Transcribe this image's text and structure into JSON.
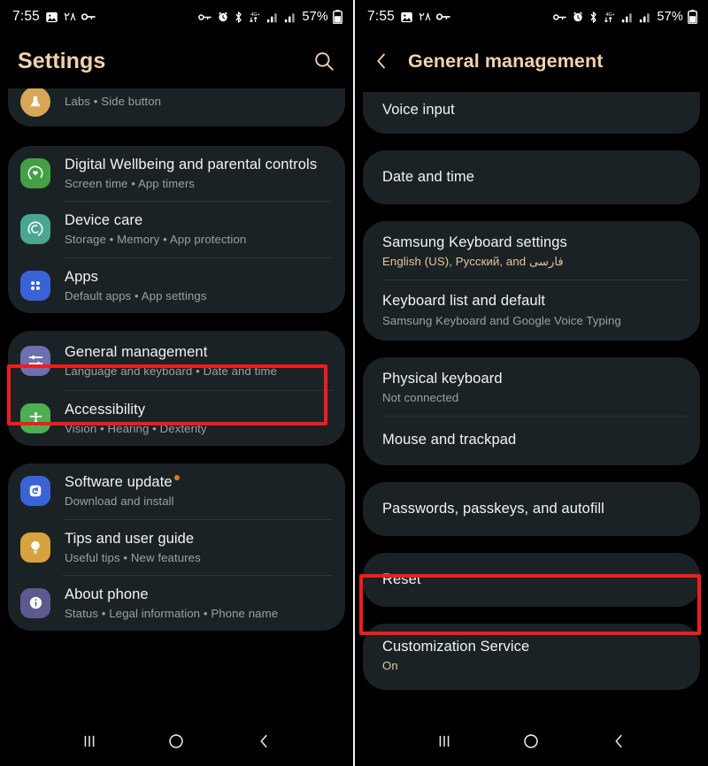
{
  "statusbar": {
    "time": "7:55",
    "arabic_indicator": "٢٨",
    "battery_percent": "57%",
    "icons": [
      "image-icon",
      "sim-key-icon",
      "vpn-key-icon",
      "alarm-icon",
      "bluetooth-icon",
      "data-transfer-4g-icon",
      "signal-bars-icon",
      "signal-bars-2-icon",
      "battery-icon"
    ]
  },
  "accent_color": "#f0d2ae",
  "highlight_color": "#ef1d1d",
  "left_screen": {
    "header": {
      "title": "Settings",
      "search_icon": "search-icon"
    },
    "groups": [
      {
        "clipped_top": true,
        "items": [
          {
            "label": "",
            "sub": "Labs  •  Side button",
            "icon": "labs-icon",
            "icon_color": "#d7a757",
            "partial": true
          }
        ]
      },
      {
        "items": [
          {
            "label": "Digital Wellbeing and parental controls",
            "sub": "Screen time  •  App timers",
            "icon": "wellbeing-icon",
            "icon_color": "#43a047"
          },
          {
            "label": "Device care",
            "sub": "Storage  •  Memory  •  App protection",
            "icon": "device-care-icon",
            "icon_color": "#4aa68f"
          },
          {
            "label": "Apps",
            "sub": "Default apps  •  App settings",
            "icon": "apps-icon",
            "icon_color": "#3a63d8"
          }
        ]
      },
      {
        "highlighted_index": 0,
        "items": [
          {
            "label": "General management",
            "sub": "Language and keyboard  •  Date and time",
            "icon": "sliders-icon",
            "icon_color": "#6e6fae"
          },
          {
            "label": "Accessibility",
            "sub": "Vision  •  Hearing  •  Dexterity",
            "icon": "accessibility-icon",
            "icon_color": "#4caf50"
          }
        ]
      },
      {
        "items": [
          {
            "label": "Software update",
            "sub": "Download and install",
            "icon": "software-update-icon",
            "icon_color": "#3a63d8",
            "badge": true
          },
          {
            "label": "Tips and user guide",
            "sub": "Useful tips  •  New features",
            "icon": "lightbulb-icon",
            "icon_color": "#d7a33f"
          },
          {
            "label": "About phone",
            "sub": "Status  •  Legal information  •  Phone name",
            "icon": "info-icon",
            "icon_color": "#5c5a8e"
          }
        ]
      }
    ]
  },
  "right_screen": {
    "header": {
      "back_icon": "back-chevron-icon",
      "title": "General management"
    },
    "groups": [
      {
        "clipped_top": true,
        "items": [
          {
            "label": "Voice input",
            "sub": ""
          }
        ]
      },
      {
        "items": [
          {
            "label": "Date and time",
            "sub": ""
          }
        ]
      },
      {
        "items": [
          {
            "label": "Samsung Keyboard settings",
            "sub": "English (US), Русский, and فارسی",
            "sub_accent": true
          },
          {
            "label": "Keyboard list and default",
            "sub": "Samsung Keyboard and Google Voice Typing"
          }
        ]
      },
      {
        "items": [
          {
            "label": "Physical keyboard",
            "sub": "Not connected"
          },
          {
            "label": "Mouse and trackpad",
            "sub": ""
          }
        ]
      },
      {
        "items": [
          {
            "label": "Passwords, passkeys, and autofill",
            "sub": ""
          }
        ]
      },
      {
        "highlighted_index": 0,
        "items": [
          {
            "label": "Reset",
            "sub": ""
          }
        ]
      },
      {
        "items": [
          {
            "label": "Customization Service",
            "sub": "On",
            "sub_accent": true
          }
        ]
      }
    ]
  },
  "navbar": {
    "recents_label": "recents-icon",
    "home_label": "home-icon",
    "back_label": "back-icon"
  }
}
